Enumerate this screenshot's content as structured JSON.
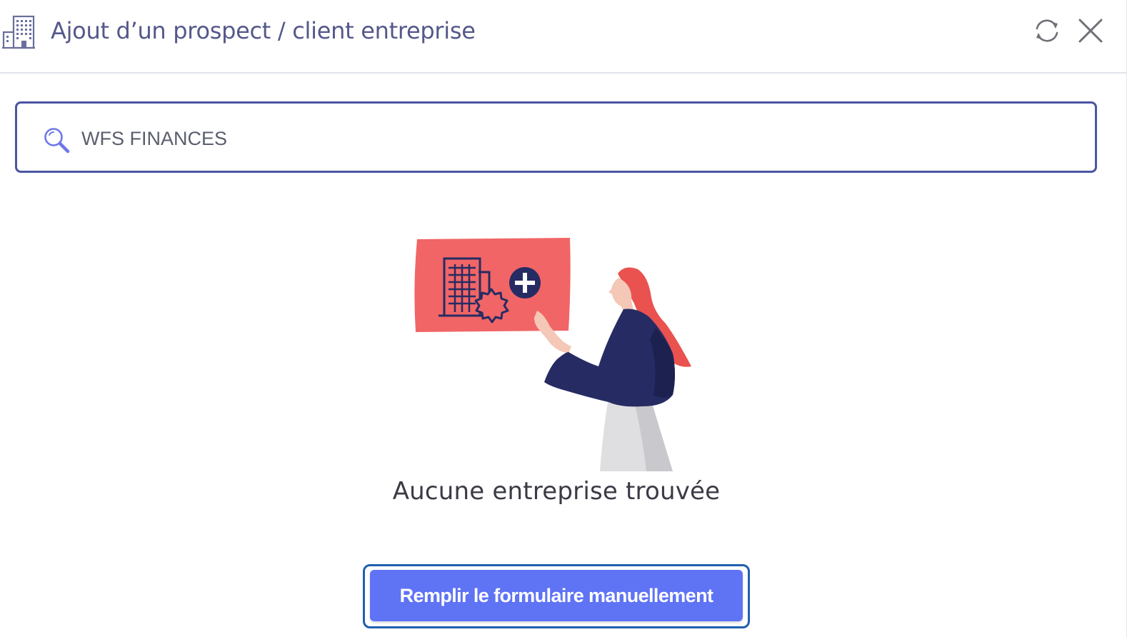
{
  "header": {
    "title": "Ajout d’un prospect / client entreprise",
    "icon": "building-icon",
    "actions": {
      "refresh_icon": "refresh-icon",
      "close_icon": "close-icon"
    }
  },
  "search": {
    "value": "WFS FINANCES",
    "icon": "search-icon"
  },
  "empty_state": {
    "illustration": "add-company-illustration",
    "message": "Aucune entreprise trouvée"
  },
  "actions": {
    "manual_form_label": "Remplir le formulaire manuellement"
  },
  "colors": {
    "title": "#54588a",
    "search_border": "#4a55a3",
    "button_bg": "#5f73f5",
    "button_focus": "#1f5fb0",
    "illustration_red": "#f16566",
    "illustration_navy": "#262c63"
  }
}
